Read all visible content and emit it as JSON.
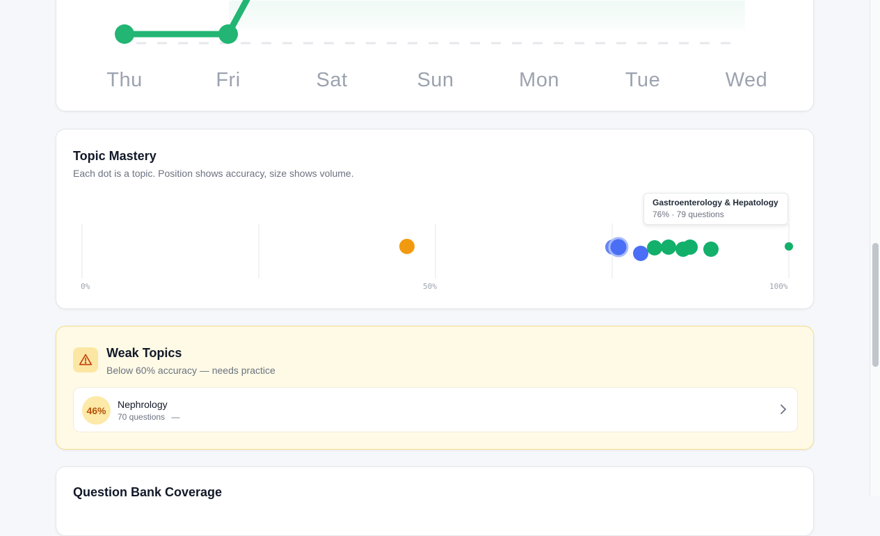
{
  "activity_chart": {
    "days": [
      "Thu",
      "Fri",
      "Sat",
      "Sun",
      "Mon",
      "Tue",
      "Wed"
    ],
    "line_color": "#22b573"
  },
  "topic_mastery": {
    "title": "Topic Mastery",
    "subtitle": "Each dot is a topic. Position shows accuracy, size shows volume.",
    "axis_labels": [
      "0%",
      "50%",
      "100%"
    ],
    "tooltip": {
      "title": "Gastroenterology & Hepatology",
      "detail": "76% · 79 questions"
    },
    "colors": {
      "weak": "#f29a0f",
      "medium": "#4a6ef5",
      "strong": "#12b06a"
    }
  },
  "weak_topics": {
    "title": "Weak Topics",
    "subtitle": "Below 60% accuracy — needs practice",
    "icon": "warning-icon",
    "items": [
      {
        "percent": "46%",
        "name": "Nephrology",
        "questions": "70 questions",
        "trend": "—"
      }
    ]
  },
  "question_bank": {
    "title": "Question Bank Coverage"
  }
}
